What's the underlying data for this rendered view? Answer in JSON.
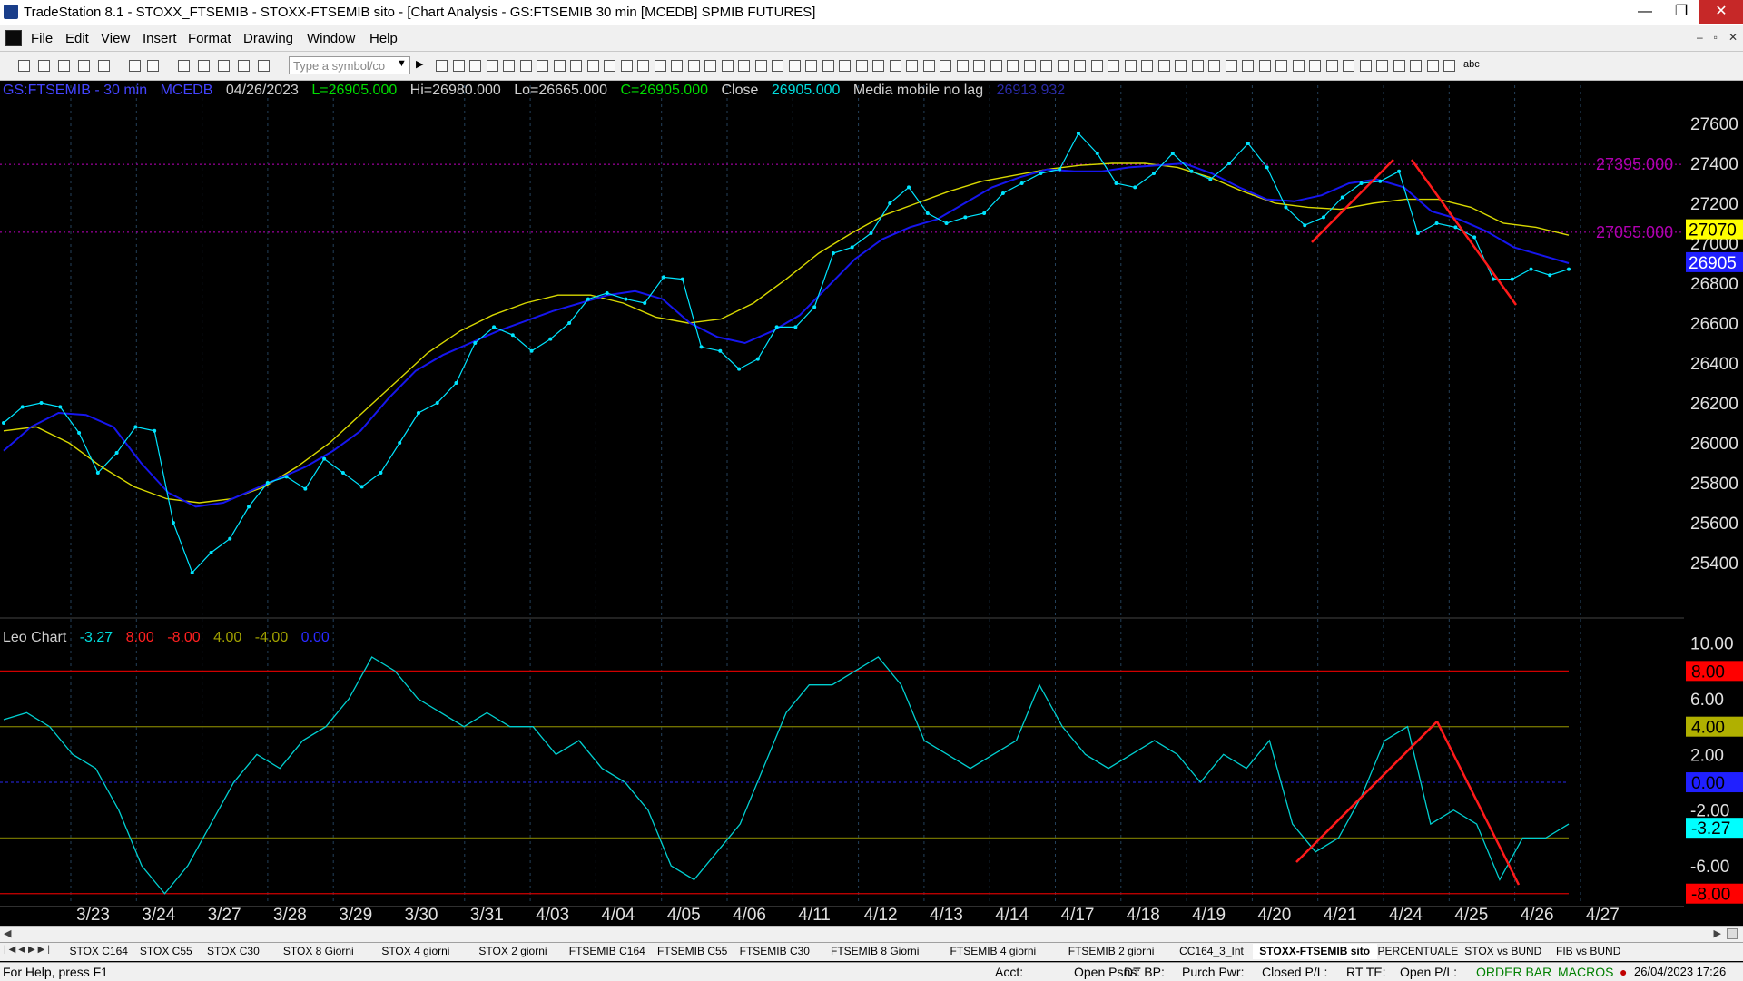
{
  "window": {
    "title": "TradeStation 8.1 - STOXX_FTSEMIB - STOXX-FTSEMIB sito - [Chart Analysis - GS:FTSEMIB  30 min  [MCEDB] SPMIB FUTURES]",
    "controls": [
      "—",
      "❐",
      "✕"
    ]
  },
  "menu": {
    "items": [
      "File",
      "Edit",
      "View",
      "Insert",
      "Format",
      "Drawing",
      "Window",
      "Help"
    ],
    "mdi_controls": [
      "–",
      "▫",
      "✕"
    ]
  },
  "toolbar": {
    "symbol_placeholder": "Type a symbol/co",
    "text_tool": "abc"
  },
  "chart_header": {
    "symbol": "GS:FTSEMIB - 30 min",
    "data_source": "MCEDB",
    "date": "04/26/2023",
    "last": "L=26905.000",
    "high": "Hi=26980.000",
    "low": "Lo=26665.000",
    "close": "C=26905.000",
    "close_label": "Close",
    "close_value": "26905.000",
    "indicator_name": "Media mobile no lag",
    "indicator_value": "26913.932"
  },
  "subpanel_header": {
    "name": "Leo Chart",
    "values": [
      "-3.27",
      "8.00",
      "-8.00",
      "4.00",
      "-4.00",
      "0.00"
    ]
  },
  "colors": {
    "background": "#000000",
    "price": "#00e5ff",
    "ma_fast": "#1616ee",
    "ma_slow": "#d8d800",
    "trendline": "#ff1a1a",
    "level_line": "#c000c0",
    "header_green": "#00dd00",
    "header_blue": "#4444ff"
  },
  "chart_data": [
    {
      "type": "line",
      "panel": "price",
      "ylim": [
        25200,
        27700
      ],
      "y_ticks": [
        "27600",
        "27400",
        "27200",
        "27000",
        "26800",
        "26600",
        "26400",
        "26200",
        "26000",
        "25800",
        "25600",
        "25400"
      ],
      "x_ticks": [
        "3/23",
        "3/24",
        "3/27",
        "3/28",
        "3/29",
        "3/30",
        "3/31",
        "4/03",
        "4/04",
        "4/05",
        "4/06",
        "4/11",
        "4/12",
        "4/13",
        "4/14",
        "4/17",
        "4/18",
        "4/19",
        "4/20",
        "4/21",
        "4/24",
        "4/25",
        "4/26",
        "4/27"
      ],
      "series": [
        {
          "name": "GS:FTSEMIB",
          "color": "#00e5ff",
          "values": [
            26100,
            26180,
            26200,
            26180,
            26050,
            25850,
            25950,
            26080,
            26060,
            25600,
            25350,
            25450,
            25520,
            25680,
            25800,
            25830,
            25770,
            25920,
            25850,
            25780,
            25850,
            26000,
            26150,
            26200,
            26300,
            26500,
            26580,
            26540,
            26460,
            26520,
            26600,
            26720,
            26750,
            26720,
            26700,
            26830,
            26820,
            26480,
            26460,
            26370,
            26420,
            26580,
            26580,
            26680,
            26950,
            26980,
            27050,
            27200,
            27280,
            27150,
            27100,
            27130,
            27150,
            27250,
            27300,
            27350,
            27370,
            27550,
            27450,
            27300,
            27280,
            27350,
            27450,
            27360,
            27320,
            27400,
            27500,
            27380,
            27180,
            27090,
            27130,
            27230,
            27300,
            27310,
            27360,
            27050,
            27100,
            27080,
            27030,
            26820,
            26820,
            26870,
            26840,
            26870
          ]
        },
        {
          "name": "MA1",
          "color": "#1616ee",
          "values": [
            25960,
            26080,
            26150,
            26140,
            26080,
            25900,
            25750,
            25680,
            25700,
            25760,
            25820,
            25880,
            25960,
            26060,
            26220,
            26360,
            26440,
            26500,
            26560,
            26610,
            26660,
            26700,
            26740,
            26760,
            26720,
            26600,
            26530,
            26500,
            26560,
            26640,
            26780,
            26920,
            27020,
            27080,
            27120,
            27200,
            27280,
            27330,
            27370,
            27360,
            27360,
            27380,
            27390,
            27400,
            27350,
            27280,
            27220,
            27210,
            27240,
            27300,
            27320,
            27280,
            27160,
            27120,
            27060,
            26980,
            26940,
            26900
          ]
        },
        {
          "name": "MA2",
          "color": "#d8d800",
          "values": [
            26060,
            26080,
            26000,
            25880,
            25780,
            25720,
            25700,
            25720,
            25780,
            25880,
            26000,
            26150,
            26300,
            26450,
            26560,
            26640,
            26700,
            26740,
            26740,
            26700,
            26630,
            26600,
            26620,
            26700,
            26820,
            26950,
            27050,
            27140,
            27200,
            27260,
            27310,
            27340,
            27370,
            27390,
            27400,
            27400,
            27380,
            27330,
            27260,
            27200,
            27180,
            27170,
            27200,
            27220,
            27220,
            27180,
            27100,
            27080,
            27040
          ]
        }
      ],
      "levels": [
        27395.0,
        27055.0
      ],
      "level_labels": [
        "27395.000",
        "27055.000"
      ],
      "last_price_labels": [
        "27070",
        "26905"
      ]
    },
    {
      "type": "line",
      "panel": "Leo Chart",
      "ylim": [
        -8.8,
        10.5
      ],
      "y_ticks": [
        "10.00",
        "6.00",
        "2.00",
        "-2.00",
        "-6.00"
      ],
      "level_labels": [
        "8.00",
        "4.00",
        "0.00",
        "-3.27",
        "-8.00"
      ],
      "levels": [
        8,
        4,
        0,
        -4,
        -8
      ],
      "series": [
        {
          "name": "Leo Chart",
          "color": "#00cfd0",
          "values": [
            4.5,
            5,
            4,
            2,
            1,
            -2,
            -6,
            -8,
            -6,
            -3,
            0,
            2,
            1,
            3,
            4,
            6,
            9,
            8,
            6,
            5,
            4,
            5,
            4,
            4,
            2,
            3,
            1,
            0,
            -2,
            -6,
            -7,
            -5,
            -3,
            1,
            5,
            7,
            7,
            8,
            9,
            7,
            3,
            2,
            1,
            2,
            3,
            7,
            4,
            2,
            1,
            2,
            3,
            2,
            0,
            2,
            1,
            3,
            -3,
            -5,
            -4,
            -1,
            3,
            4,
            -3,
            -2,
            -3,
            -7,
            -4,
            -4,
            -3
          ]
        },
        {
          "name": "Level 8",
          "color": "#ff0000",
          "values": [
            8
          ]
        },
        {
          "name": "Level 4",
          "color": "#808000",
          "values": [
            4
          ]
        },
        {
          "name": "Level 0",
          "color": "#0000ff",
          "values": [
            0
          ]
        },
        {
          "name": "Level -4",
          "color": "#808000",
          "values": [
            -4
          ]
        },
        {
          "name": "Level -8",
          "color": "#ff0000",
          "values": [
            -8
          ]
        }
      ]
    }
  ],
  "sheet_tabs": [
    "STOX C164",
    "STOX C55",
    "STOX  C30",
    "STOX  8 Giorni",
    "STOX 4 giorni",
    "STOX  2 giorni",
    "FTSEMIB C164",
    "FTSEMIB C55",
    "FTSEMIB C30",
    "FTSEMIB  8 Giorni",
    "FTSEMIB  4 giorni",
    "FTSEMIB  2 giorni",
    "CC164_3_Int",
    "STOXX-FTSEMIB sito",
    "PERCENTUALE",
    "STOX vs BUND",
    "FIB vs BUND"
  ],
  "active_tab": "STOXX-FTSEMIB sito",
  "status_bar": {
    "help": "For Help, press F1",
    "acct": "Acct:",
    "open_psns": "Open Psns:",
    "dt_bp": "DT BP:",
    "purch_pwr": "Purch Pwr:",
    "closed_pl": "Closed P/L:",
    "rt_te": "RT TE:",
    "open_pl": "Open P/L:",
    "order_bar": "ORDER BAR",
    "macros": "MACROS",
    "datetime": "26/04/2023 17:26"
  }
}
